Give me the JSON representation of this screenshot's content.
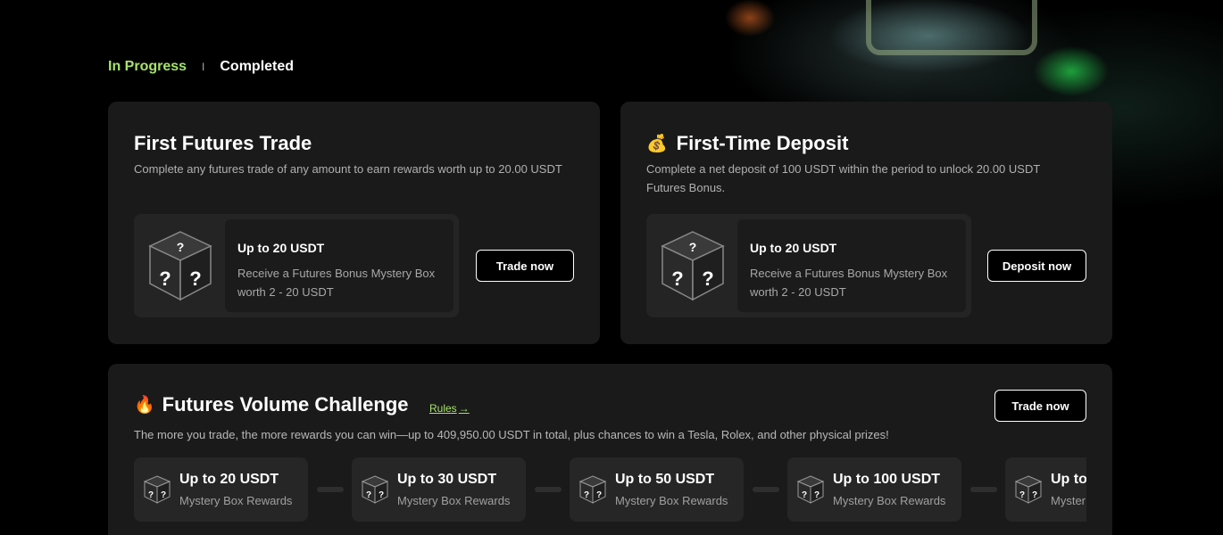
{
  "tabs": {
    "active": "In Progress",
    "separator": "I",
    "other": "Completed"
  },
  "first_trade": {
    "title": "First Futures Trade",
    "description": "Complete any futures trade of any amount to earn rewards worth up to 20.00 USDT",
    "reward_title": "Up to 20 USDT",
    "reward_text": "Receive a Futures Bonus Mystery Box worth 2 - 20 USDT",
    "button": "Trade now"
  },
  "first_deposit": {
    "icon": "money-bag-icon",
    "icon_glyph": "💰",
    "title": "First-Time Deposit",
    "description": "Complete a net deposit of 100 USDT within the period to unlock 20.00 USDT Futures Bonus.",
    "reward_title": "Up to 20 USDT",
    "reward_text": "Receive a Futures Bonus Mystery Box worth 2 - 20 USDT",
    "button": "Deposit now"
  },
  "challenge": {
    "icon": "fire-icon",
    "icon_glyph": "🔥",
    "title": "Futures Volume Challenge",
    "rules_label": "Rules",
    "rules_arrow": "→",
    "description": "The more you trade, the more rewards you can win—up to 409,950.00 USDT in total, plus chances to win a Tesla, Rolex, and other physical prizes!",
    "button": "Trade now",
    "tiers": [
      {
        "title": "Up to 20 USDT",
        "subtitle": "Mystery Box Rewards"
      },
      {
        "title": "Up to 30 USDT",
        "subtitle": "Mystery Box Rewards"
      },
      {
        "title": "Up to 50 USDT",
        "subtitle": "Mystery Box Rewards"
      },
      {
        "title": "Up to 100 USDT",
        "subtitle": "Mystery Box Rewards"
      },
      {
        "title": "Up to",
        "subtitle": "Myster"
      }
    ]
  },
  "colors": {
    "accent": "#a6e36a",
    "card": "#1a1a1a",
    "background": "#000000"
  }
}
